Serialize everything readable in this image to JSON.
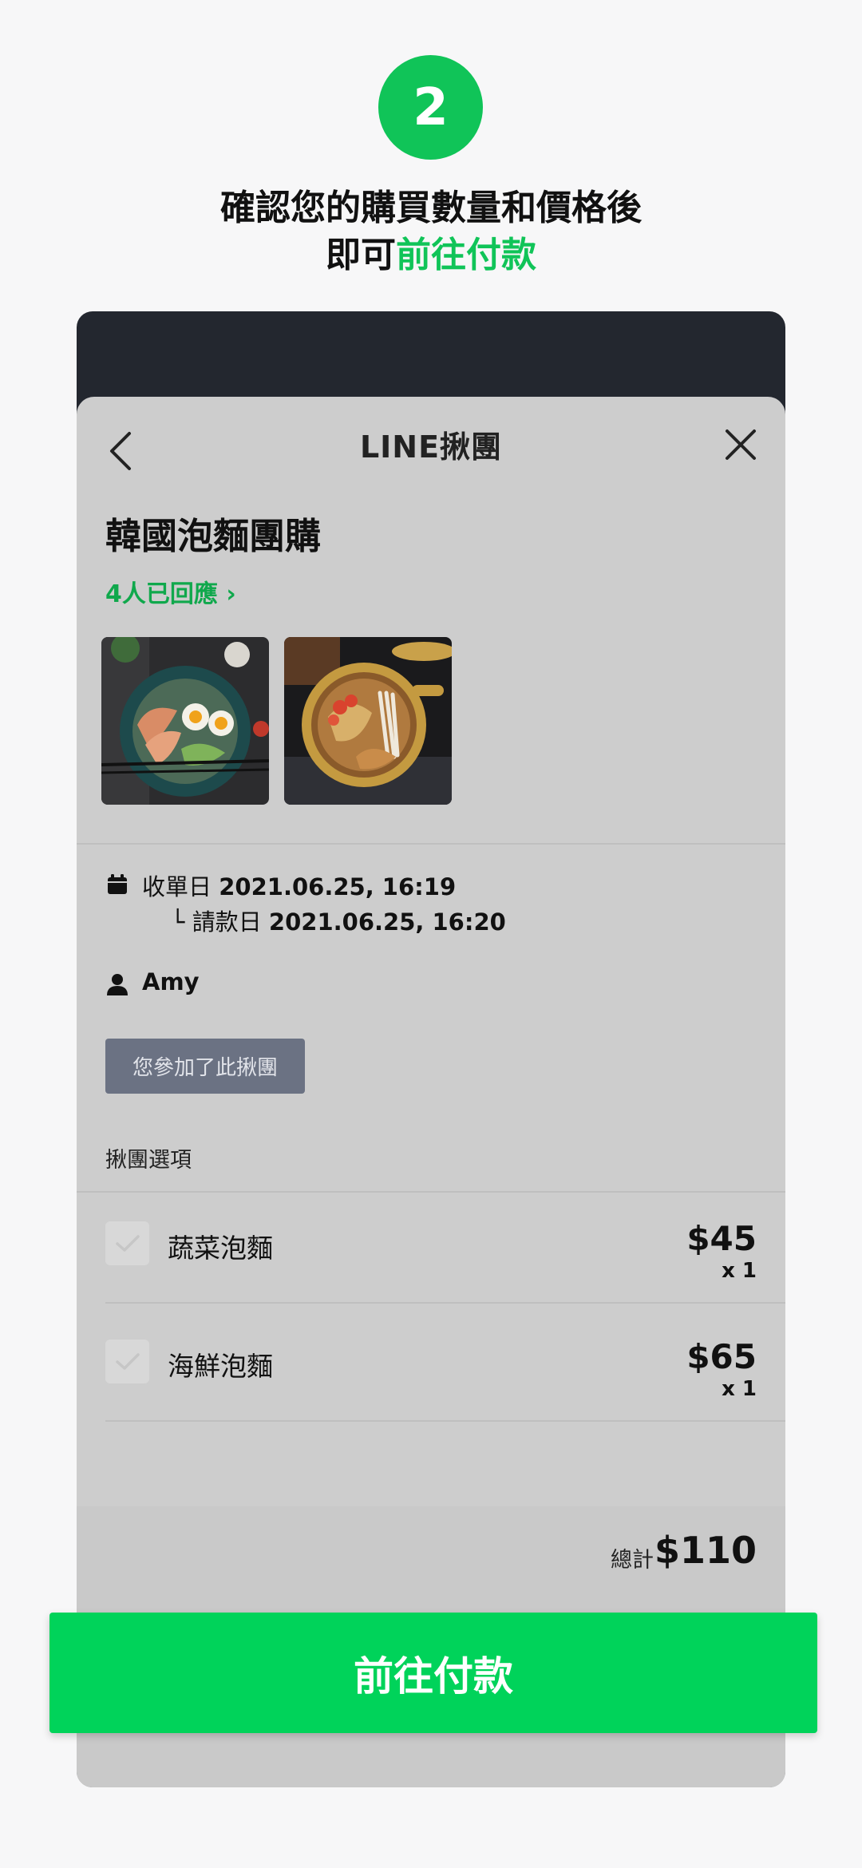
{
  "step": {
    "number": "2"
  },
  "instruction": {
    "line1": "確認您的購買數量和價格後",
    "line2_prefix": "即可",
    "line2_highlight": "前往付款"
  },
  "header": {
    "title": "LINE揪團"
  },
  "group": {
    "title": "韓國泡麵團購",
    "responses": "4人已回應 ›"
  },
  "details": {
    "close_label": "收單日",
    "close_date": "2021.06.25, 16:19",
    "pay_prefix": "└",
    "pay_label": "請款日",
    "pay_date": "2021.06.25, 16:20",
    "organizer": "Amy"
  },
  "joined_button": "您參加了此揪團",
  "options_label": "揪團選項",
  "options": [
    {
      "name": "蔬菜泡麵",
      "price": "$45",
      "qty": "x 1"
    },
    {
      "name": "海鮮泡麵",
      "price": "$65",
      "qty": "x 1"
    }
  ],
  "total": {
    "label": "總計",
    "value": "$110"
  },
  "pay_button": "前往付款",
  "colors": {
    "accent": "#10c458",
    "button": "#00d35a",
    "device_frame": "#23272f"
  }
}
